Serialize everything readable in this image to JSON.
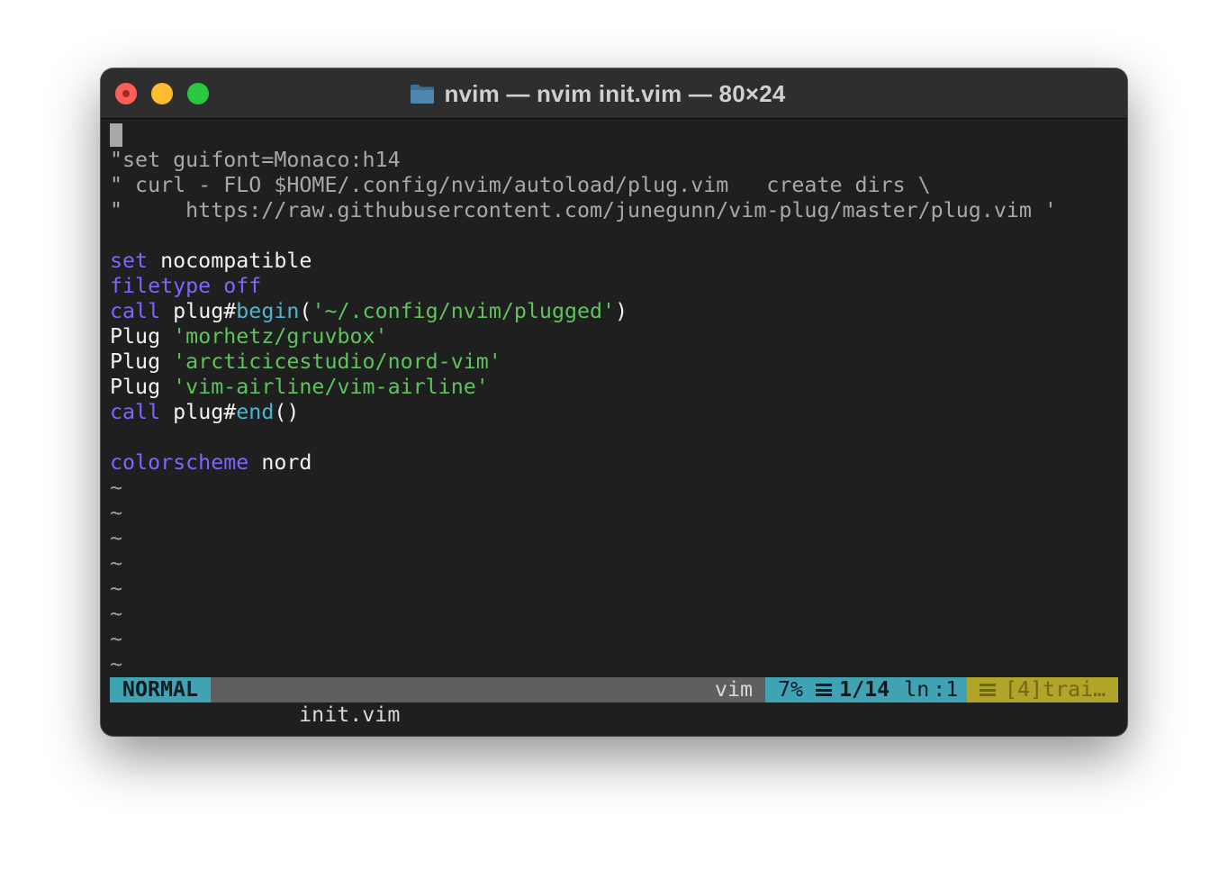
{
  "window": {
    "title": "nvim — nvim init.vim — 80×24",
    "colors": {
      "close": "#ff5f57",
      "minimize": "#febc2e",
      "maximize": "#28c840",
      "background": "#1f1f1f",
      "keyword": "#7c66ff",
      "function": "#4fb5cc",
      "string": "#5dc35d",
      "comment": "#a8a8a8"
    }
  },
  "editor": {
    "comments": [
      "\"set guifont=Monaco:h14",
      "\" curl - FLO $HOME/.config/nvim/autoload/plug.vim   create dirs \\",
      "\"     https://raw.githubusercontent.com/junegunn/vim-plug/master/plug.vim '"
    ],
    "line_set": {
      "keyword": "set",
      "arg": "nocompatible"
    },
    "line_filetype": {
      "keyword": "filetype",
      "arg": "off"
    },
    "line_begin": {
      "keyword": "call",
      "prefix": "plug#",
      "func": "begin",
      "open": "(",
      "string": "'~/.config/nvim/plugged'",
      "close": ")"
    },
    "plugs": [
      {
        "cmd": "Plug",
        "string": "'morhetz/gruvbox'"
      },
      {
        "cmd": "Plug",
        "string": "'arcticicestudio/nord-vim'"
      },
      {
        "cmd": "Plug",
        "string": "'vim-airline/vim-airline'"
      }
    ],
    "line_end": {
      "keyword": "call",
      "prefix": "plug#",
      "func": "end",
      "parens": "()"
    },
    "line_colorscheme": {
      "keyword": "colorscheme",
      "arg": "nord"
    },
    "tilde": "~"
  },
  "statusline": {
    "mode": "NORMAL",
    "filename": "init.vim",
    "filetype": "vim",
    "percent": "7%",
    "line_pos": "1/14",
    "col_label": "ln",
    "col_value": ":1",
    "warning": "[4]trai…"
  }
}
